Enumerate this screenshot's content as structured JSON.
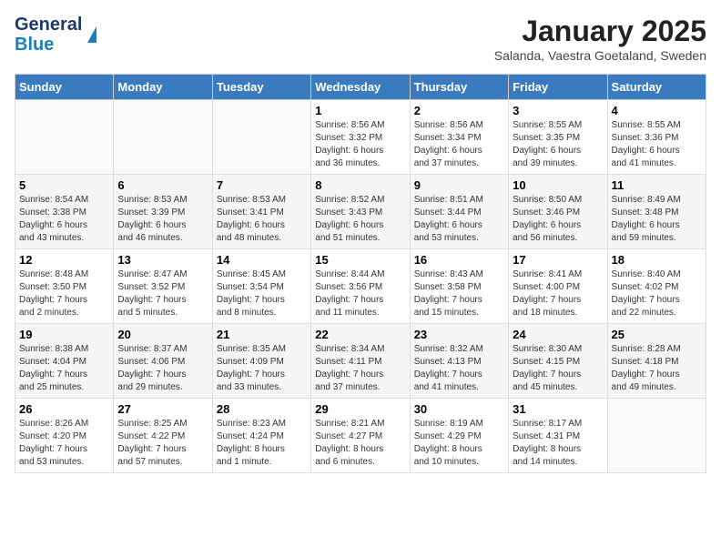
{
  "header": {
    "logo_general": "General",
    "logo_blue": "Blue",
    "month": "January 2025",
    "location": "Salanda, Vaestra Goetaland, Sweden"
  },
  "days_of_week": [
    "Sunday",
    "Monday",
    "Tuesday",
    "Wednesday",
    "Thursday",
    "Friday",
    "Saturday"
  ],
  "weeks": [
    [
      {
        "day": "",
        "info": ""
      },
      {
        "day": "",
        "info": ""
      },
      {
        "day": "",
        "info": ""
      },
      {
        "day": "1",
        "info": "Sunrise: 8:56 AM\nSunset: 3:32 PM\nDaylight: 6 hours\nand 36 minutes."
      },
      {
        "day": "2",
        "info": "Sunrise: 8:56 AM\nSunset: 3:34 PM\nDaylight: 6 hours\nand 37 minutes."
      },
      {
        "day": "3",
        "info": "Sunrise: 8:55 AM\nSunset: 3:35 PM\nDaylight: 6 hours\nand 39 minutes."
      },
      {
        "day": "4",
        "info": "Sunrise: 8:55 AM\nSunset: 3:36 PM\nDaylight: 6 hours\nand 41 minutes."
      }
    ],
    [
      {
        "day": "5",
        "info": "Sunrise: 8:54 AM\nSunset: 3:38 PM\nDaylight: 6 hours\nand 43 minutes."
      },
      {
        "day": "6",
        "info": "Sunrise: 8:53 AM\nSunset: 3:39 PM\nDaylight: 6 hours\nand 46 minutes."
      },
      {
        "day": "7",
        "info": "Sunrise: 8:53 AM\nSunset: 3:41 PM\nDaylight: 6 hours\nand 48 minutes."
      },
      {
        "day": "8",
        "info": "Sunrise: 8:52 AM\nSunset: 3:43 PM\nDaylight: 6 hours\nand 51 minutes."
      },
      {
        "day": "9",
        "info": "Sunrise: 8:51 AM\nSunset: 3:44 PM\nDaylight: 6 hours\nand 53 minutes."
      },
      {
        "day": "10",
        "info": "Sunrise: 8:50 AM\nSunset: 3:46 PM\nDaylight: 6 hours\nand 56 minutes."
      },
      {
        "day": "11",
        "info": "Sunrise: 8:49 AM\nSunset: 3:48 PM\nDaylight: 6 hours\nand 59 minutes."
      }
    ],
    [
      {
        "day": "12",
        "info": "Sunrise: 8:48 AM\nSunset: 3:50 PM\nDaylight: 7 hours\nand 2 minutes."
      },
      {
        "day": "13",
        "info": "Sunrise: 8:47 AM\nSunset: 3:52 PM\nDaylight: 7 hours\nand 5 minutes."
      },
      {
        "day": "14",
        "info": "Sunrise: 8:45 AM\nSunset: 3:54 PM\nDaylight: 7 hours\nand 8 minutes."
      },
      {
        "day": "15",
        "info": "Sunrise: 8:44 AM\nSunset: 3:56 PM\nDaylight: 7 hours\nand 11 minutes."
      },
      {
        "day": "16",
        "info": "Sunrise: 8:43 AM\nSunset: 3:58 PM\nDaylight: 7 hours\nand 15 minutes."
      },
      {
        "day": "17",
        "info": "Sunrise: 8:41 AM\nSunset: 4:00 PM\nDaylight: 7 hours\nand 18 minutes."
      },
      {
        "day": "18",
        "info": "Sunrise: 8:40 AM\nSunset: 4:02 PM\nDaylight: 7 hours\nand 22 minutes."
      }
    ],
    [
      {
        "day": "19",
        "info": "Sunrise: 8:38 AM\nSunset: 4:04 PM\nDaylight: 7 hours\nand 25 minutes."
      },
      {
        "day": "20",
        "info": "Sunrise: 8:37 AM\nSunset: 4:06 PM\nDaylight: 7 hours\nand 29 minutes."
      },
      {
        "day": "21",
        "info": "Sunrise: 8:35 AM\nSunset: 4:09 PM\nDaylight: 7 hours\nand 33 minutes."
      },
      {
        "day": "22",
        "info": "Sunrise: 8:34 AM\nSunset: 4:11 PM\nDaylight: 7 hours\nand 37 minutes."
      },
      {
        "day": "23",
        "info": "Sunrise: 8:32 AM\nSunset: 4:13 PM\nDaylight: 7 hours\nand 41 minutes."
      },
      {
        "day": "24",
        "info": "Sunrise: 8:30 AM\nSunset: 4:15 PM\nDaylight: 7 hours\nand 45 minutes."
      },
      {
        "day": "25",
        "info": "Sunrise: 8:28 AM\nSunset: 4:18 PM\nDaylight: 7 hours\nand 49 minutes."
      }
    ],
    [
      {
        "day": "26",
        "info": "Sunrise: 8:26 AM\nSunset: 4:20 PM\nDaylight: 7 hours\nand 53 minutes."
      },
      {
        "day": "27",
        "info": "Sunrise: 8:25 AM\nSunset: 4:22 PM\nDaylight: 7 hours\nand 57 minutes."
      },
      {
        "day": "28",
        "info": "Sunrise: 8:23 AM\nSunset: 4:24 PM\nDaylight: 8 hours\nand 1 minute."
      },
      {
        "day": "29",
        "info": "Sunrise: 8:21 AM\nSunset: 4:27 PM\nDaylight: 8 hours\nand 6 minutes."
      },
      {
        "day": "30",
        "info": "Sunrise: 8:19 AM\nSunset: 4:29 PM\nDaylight: 8 hours\nand 10 minutes."
      },
      {
        "day": "31",
        "info": "Sunrise: 8:17 AM\nSunset: 4:31 PM\nDaylight: 8 hours\nand 14 minutes."
      },
      {
        "day": "",
        "info": ""
      }
    ]
  ]
}
